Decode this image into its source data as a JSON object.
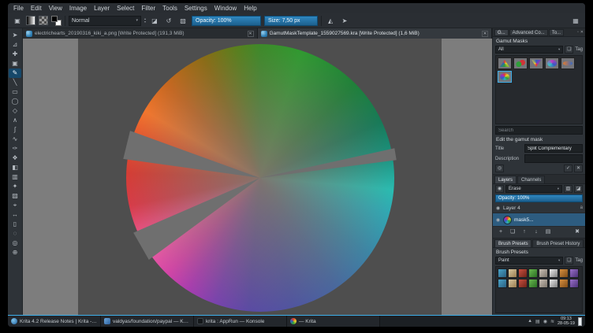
{
  "menubar": {
    "items": [
      "File",
      "Edit",
      "View",
      "Image",
      "Layer",
      "Select",
      "Filter",
      "Tools",
      "Settings",
      "Window",
      "Help"
    ]
  },
  "toolbar": {
    "blend_mode": "Normal",
    "opacity_label": "Opacity:",
    "opacity_value": "100%",
    "size_label": "Size:",
    "size_value": "7,50 px"
  },
  "glyphs": {
    "dropdown": "▾",
    "spin_up": "▴",
    "spin_down": "▾",
    "close": "✕",
    "float": "▫",
    "tag": "❏",
    "eye": "◉",
    "toolbox_toggle": "▣",
    "eraser_mode": "◪",
    "reload_original": "↺",
    "preserve_alpha": "▧",
    "mirror": "◭",
    "snap": "➤",
    "workspace": "▦",
    "inherit_alpha": "▧",
    "alpha_lock": "◪",
    "preview": "◎",
    "save": "✓",
    "cancel": "✕",
    "tray_up": "▲",
    "tray_net": "≋",
    "tray_vol": "◉",
    "tray_clip": "▤"
  },
  "tabs": [
    {
      "title": "electrichearts_20190316_kiki_a.png [Write Protected] (191,3 MiB)"
    },
    {
      "title": "GamutMaskTemplate_1559027569.kra [Write Protected] (1,6 MiB)"
    }
  ],
  "toolbox": {
    "tools": [
      {
        "name": "select-shapes",
        "glyph": "➤"
      },
      {
        "name": "transform",
        "glyph": "⊿"
      },
      {
        "name": "move",
        "glyph": "✚"
      },
      {
        "name": "crop",
        "glyph": "▣"
      },
      {
        "name": "freehand-brush",
        "glyph": "✎"
      },
      {
        "name": "line",
        "glyph": "╲"
      },
      {
        "name": "rectangle",
        "glyph": "▭"
      },
      {
        "name": "ellipse",
        "glyph": "◯"
      },
      {
        "name": "polygon",
        "glyph": "◇"
      },
      {
        "name": "polyline",
        "glyph": "∧"
      },
      {
        "name": "bezier",
        "glyph": "∫"
      },
      {
        "name": "freehand-path",
        "glyph": "∿"
      },
      {
        "name": "dynamic-brush",
        "glyph": "✑"
      },
      {
        "name": "multibrush",
        "glyph": "❖"
      },
      {
        "name": "fill",
        "glyph": "◧"
      },
      {
        "name": "gradient",
        "glyph": "▥"
      },
      {
        "name": "color-sampler",
        "glyph": "✦"
      },
      {
        "name": "pattern-edit",
        "glyph": "▨"
      },
      {
        "name": "assistants",
        "glyph": "⌖"
      },
      {
        "name": "measure",
        "glyph": "↔"
      },
      {
        "name": "rect-select",
        "glyph": "▯"
      },
      {
        "name": "ellipse-select",
        "glyph": "◌"
      },
      {
        "name": "outline-select",
        "glyph": "◎"
      },
      {
        "name": "zoom",
        "glyph": "⊕"
      }
    ]
  },
  "gamut": {
    "docker_tabs": [
      "G...",
      "Advanced Co...",
      "To..."
    ],
    "title": "Gamut Masks",
    "filter_value": "All",
    "tag_label": "Tag",
    "search_placeholder": "Search",
    "edit_label": "Edit the gamut mask",
    "title_label": "Title",
    "title_value": "Split Complementary",
    "description_label": "Description"
  },
  "layers": {
    "tabs": [
      "Layers",
      "Channels"
    ],
    "blend_mode": "Erase",
    "opacity_label": "Opacity:",
    "opacity_value": "100%",
    "rows": [
      {
        "name": "Layer 4",
        "badge": "a"
      },
      {
        "name": "mask5...",
        "badge": ""
      }
    ],
    "buttons": [
      {
        "glyph": "+"
      },
      {
        "glyph": "❏"
      },
      {
        "glyph": "↑"
      },
      {
        "glyph": "↓"
      },
      {
        "glyph": "▤"
      },
      {
        "glyph": "✖"
      }
    ]
  },
  "brushes": {
    "tabs": [
      "Brush Presets",
      "Brush Preset History"
    ],
    "title": "Brush Presets",
    "filter_value": "Paint",
    "tag_label": "Tag"
  },
  "taskbar": {
    "items": [
      {
        "label": "Krita 4.2 Release Notes | Krita - ..."
      },
      {
        "label": "valdyas/foundation/paypal — KM..."
      },
      {
        "label": "krita : AppRun — Konsole"
      },
      {
        "label": "— Krita"
      }
    ],
    "time": "09:13",
    "date": "28-05-19"
  }
}
